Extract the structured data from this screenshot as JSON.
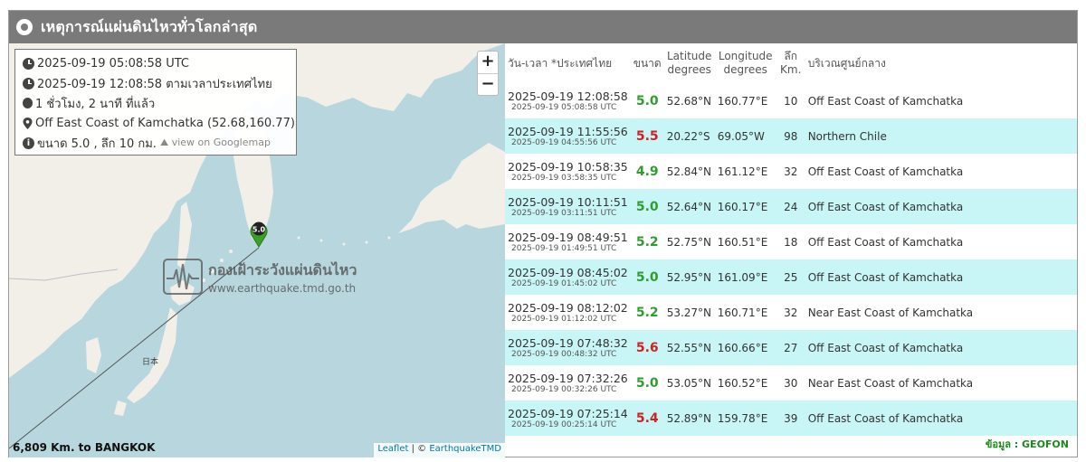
{
  "title": "เหตุการณ์แผ่นดินไหวทั่วโลกล่าสุด",
  "colors": {
    "header_bg": "#7a7a7a",
    "row_alt": "#c8f5f5",
    "mag_green": "#2e9e2e",
    "mag_red": "#d42020",
    "source": "#1a8a1a"
  },
  "info": {
    "utc": "2025-09-19 05:08:58 UTC",
    "local": "2025-09-19 12:08:58 ตามเวลาประเทศไทย",
    "ago": "1 ชั่วโมง, 2 นาที ที่แล้ว",
    "location": "Off East Coast of Kamchatka (52.68,160.77)",
    "magdepth": "ขนาด 5.0 , ลึก 10 กม.",
    "googlemap": "view on Googlemap"
  },
  "map": {
    "zoom_in": "+",
    "zoom_out": "−",
    "marker_label": "5.0",
    "distance": "6,809 Km. to BANGKOK",
    "attrib_leaflet": "Leaflet",
    "attrib_sep": " | © ",
    "attrib_tmd": "EarthquakeTMD",
    "watermark_line1": "กองเฝ้าระวังแผ่นดินไหว",
    "watermark_line2": "www.earthquake.tmd.go.th",
    "japan_label": "日本"
  },
  "table": {
    "headers": {
      "datetime": "วัน-เวลา *ประเทศไทย",
      "mag": "ขนาด",
      "lat": "Latitude degrees",
      "lon": "Longitude degrees",
      "depth": "ลึก Km.",
      "region": "บริเวณศูนย์กลาง"
    },
    "rows": [
      {
        "local": "2025-09-19 12:08:58",
        "utc": "2025-09-19 05:08:58 UTC",
        "mag": "5.0",
        "lat": "52.68°N",
        "lon": "160.77°E",
        "depth": "10",
        "region": "Off East Coast of Kamchatka",
        "color": "#2e9e2e"
      },
      {
        "local": "2025-09-19 11:55:56",
        "utc": "2025-09-19 04:55:56 UTC",
        "mag": "5.5",
        "lat": "20.22°S",
        "lon": "69.05°W",
        "depth": "98",
        "region": "Northern Chile",
        "color": "#d42020"
      },
      {
        "local": "2025-09-19 10:58:35",
        "utc": "2025-09-19 03:58:35 UTC",
        "mag": "4.9",
        "lat": "52.84°N",
        "lon": "161.12°E",
        "depth": "32",
        "region": "Off East Coast of Kamchatka",
        "color": "#2e9e2e"
      },
      {
        "local": "2025-09-19 10:11:51",
        "utc": "2025-09-19 03:11:51 UTC",
        "mag": "5.0",
        "lat": "52.64°N",
        "lon": "160.17°E",
        "depth": "24",
        "region": "Off East Coast of Kamchatka",
        "color": "#2e9e2e"
      },
      {
        "local": "2025-09-19 08:49:51",
        "utc": "2025-09-19 01:49:51 UTC",
        "mag": "5.2",
        "lat": "52.75°N",
        "lon": "160.51°E",
        "depth": "18",
        "region": "Off East Coast of Kamchatka",
        "color": "#2e9e2e"
      },
      {
        "local": "2025-09-19 08:45:02",
        "utc": "2025-09-19 01:45:02 UTC",
        "mag": "5.0",
        "lat": "52.95°N",
        "lon": "161.09°E",
        "depth": "25",
        "region": "Off East Coast of Kamchatka",
        "color": "#2e9e2e"
      },
      {
        "local": "2025-09-19 08:12:02",
        "utc": "2025-09-19 01:12:02 UTC",
        "mag": "5.2",
        "lat": "53.27°N",
        "lon": "160.71°E",
        "depth": "32",
        "region": "Near East Coast of Kamchatka",
        "color": "#2e9e2e"
      },
      {
        "local": "2025-09-19 07:48:32",
        "utc": "2025-09-19 00:48:32 UTC",
        "mag": "5.6",
        "lat": "52.55°N",
        "lon": "160.66°E",
        "depth": "27",
        "region": "Off East Coast of Kamchatka",
        "color": "#d42020"
      },
      {
        "local": "2025-09-19 07:32:26",
        "utc": "2025-09-19 00:32:26 UTC",
        "mag": "5.0",
        "lat": "53.05°N",
        "lon": "160.52°E",
        "depth": "30",
        "region": "Near East Coast of Kamchatka",
        "color": "#2e9e2e"
      },
      {
        "local": "2025-09-19 07:25:14",
        "utc": "2025-09-19 00:25:14 UTC",
        "mag": "5.4",
        "lat": "52.89°N",
        "lon": "159.78°E",
        "depth": "39",
        "region": "Off East Coast of Kamchatka",
        "color": "#d42020"
      }
    ]
  },
  "source": "ข้อมูล : GEOFON"
}
